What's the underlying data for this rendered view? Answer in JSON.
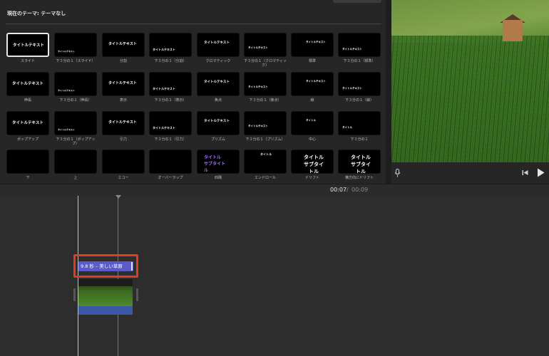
{
  "browser": {
    "theme_label": "現在のテーマ: テーマなし",
    "tiles": [
      {
        "caption": "スライド",
        "thumb_text": "タイトルテキスト",
        "selected": true
      },
      {
        "caption": "下３分の１（スライド）",
        "thumb_text": "タイトルテキスト",
        "selected": false
      },
      {
        "caption": "分割",
        "thumb_text": "タイトルテキスト",
        "selected": false
      },
      {
        "caption": "下３分の１（分割）",
        "thumb_text": "タイトルテキスト",
        "selected": false
      },
      {
        "caption": "クロマティック",
        "thumb_text": "タイトルテキスト",
        "selected": false
      },
      {
        "caption": "下３分の１（クロマティック）",
        "thumb_text": "タイトルテキスト",
        "selected": false
      },
      {
        "caption": "標準",
        "thumb_text": "タイトルテキスト",
        "selected": false
      },
      {
        "caption": "下３分の１（標準）",
        "thumb_text": "タイトルテキスト",
        "selected": false
      },
      {
        "caption": "伸長",
        "thumb_text": "タイトルテキスト",
        "selected": false
      },
      {
        "caption": "下３分の１（伸長）",
        "thumb_text": "タイトルテキスト",
        "selected": false
      },
      {
        "caption": "表示",
        "thumb_text": "タイトルテキスト",
        "selected": false
      },
      {
        "caption": "下３分の１（表示）",
        "thumb_text": "タイトルテキスト",
        "selected": false
      },
      {
        "caption": "焦点",
        "thumb_text": "タイトルテキスト",
        "selected": false
      },
      {
        "caption": "下３分の１（焦点）",
        "thumb_text": "タイトルテキスト",
        "selected": false
      },
      {
        "caption": "線",
        "thumb_text": "タイトルテキスト",
        "selected": false
      },
      {
        "caption": "下３分の１（線）",
        "thumb_text": "タイトルテキスト",
        "selected": false
      },
      {
        "caption": "ポップアップ",
        "thumb_text": "タイトルテキスト",
        "selected": false
      },
      {
        "caption": "下３分の１（ポップアップ）",
        "thumb_text": "タイトルテキスト",
        "selected": false
      },
      {
        "caption": "引力",
        "thumb_text": "タイトルテキスト",
        "selected": false
      },
      {
        "caption": "下３分の１（引力）",
        "thumb_text": "タイトルテキスト",
        "selected": false
      },
      {
        "caption": "プリズム",
        "thumb_text": "タイトルテキスト",
        "selected": false
      },
      {
        "caption": "下３分の１（プリズム）",
        "thumb_text": "タイトルテキスト",
        "selected": false
      },
      {
        "caption": "中心",
        "thumb_text": "タイトル",
        "selected": false
      },
      {
        "caption": "下３分の１",
        "thumb_text": "タイトル",
        "selected": false
      },
      {
        "caption": "下",
        "thumb_text": "",
        "selected": false
      },
      {
        "caption": "上",
        "thumb_text": "",
        "selected": false
      },
      {
        "caption": "エコー",
        "thumb_text": "",
        "selected": false
      },
      {
        "caption": "オーバーラップ",
        "thumb_text": "",
        "selected": false
      },
      {
        "caption": "四隅",
        "thumb_text": "タイトル サブタイトル",
        "selected": false
      },
      {
        "caption": "エンドロール",
        "thumb_text": "タイトル",
        "selected": false
      },
      {
        "caption": "ドリフト",
        "thumb_text": "タイトル サブタイトル",
        "selected": false
      },
      {
        "caption": "横方向にドリフト",
        "thumb_text": "タイトル サブタイトル",
        "selected": false
      }
    ]
  },
  "controls": {
    "mic_icon": "microphone-icon",
    "skip_back_icon": "skip-to-start-icon",
    "play_icon": "play-icon"
  },
  "timebar": {
    "current": "00:07",
    "separator": "/",
    "total": "00:09"
  },
  "timeline": {
    "title_clip_label": "9.8 秒 – 美しい草原",
    "highlight_color": "#e23b1e",
    "title_clip_color": "#5a5ac8",
    "audio_color": "#3a57a8",
    "playhead_color": "#e8d200"
  }
}
